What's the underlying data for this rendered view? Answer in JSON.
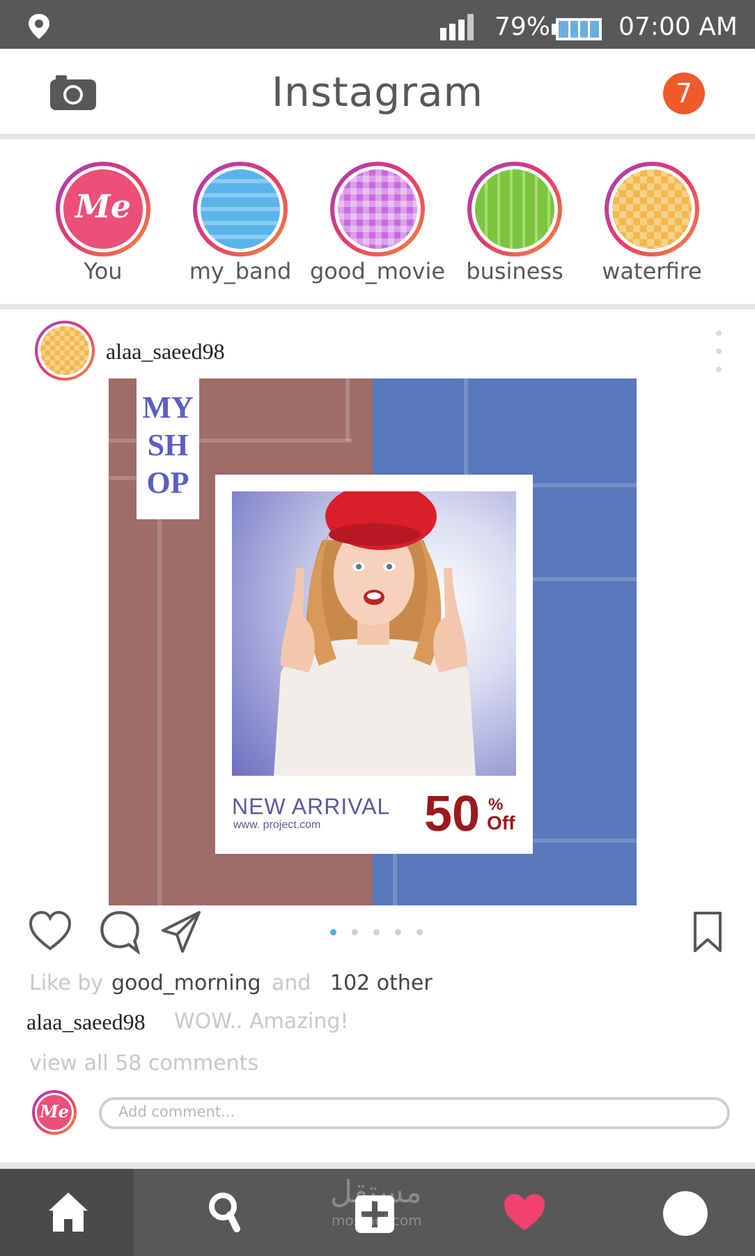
{
  "status_bar": {
    "battery": "79%",
    "time": "07:00 AM",
    "icons": [
      "location-pin-icon",
      "signal-icon",
      "battery-icon"
    ]
  },
  "header": {
    "title": "Instagram",
    "camera_icon": "camera-icon",
    "notification_count": "7",
    "accent_color": "#ef5a2b"
  },
  "stories": [
    {
      "label": "You",
      "avatar_text": "Me"
    },
    {
      "label": "my_band"
    },
    {
      "label": "good_movie"
    },
    {
      "label": "business"
    },
    {
      "label": "waterfire"
    }
  ],
  "post": {
    "username": "alaa_saeed98",
    "image": {
      "shop_text": [
        "MY",
        "SH",
        "OP"
      ],
      "headline": "NEW ARRIVAL",
      "url": "www. project.com",
      "discount_number": "50",
      "discount_percent": "%",
      "discount_off": "Off"
    },
    "likes": {
      "prefix": "Like by",
      "user": "good_morning",
      "conjunction": "and",
      "others": "102 other"
    },
    "caption": {
      "user": "alaa_saeed98",
      "text": "WOW.. Amazing!"
    },
    "view_comments": "view all 58 comments",
    "comment_avatar_text": "Me",
    "comment_placeholder": "Add comment..."
  },
  "bottom_nav": {
    "items": [
      "home-icon",
      "search-icon",
      "add-icon",
      "heart-icon",
      "profile-icon"
    ],
    "heart_color": "#f0426f"
  },
  "watermark": {
    "arabic": "مستقل",
    "latin": "mostaql.com"
  }
}
